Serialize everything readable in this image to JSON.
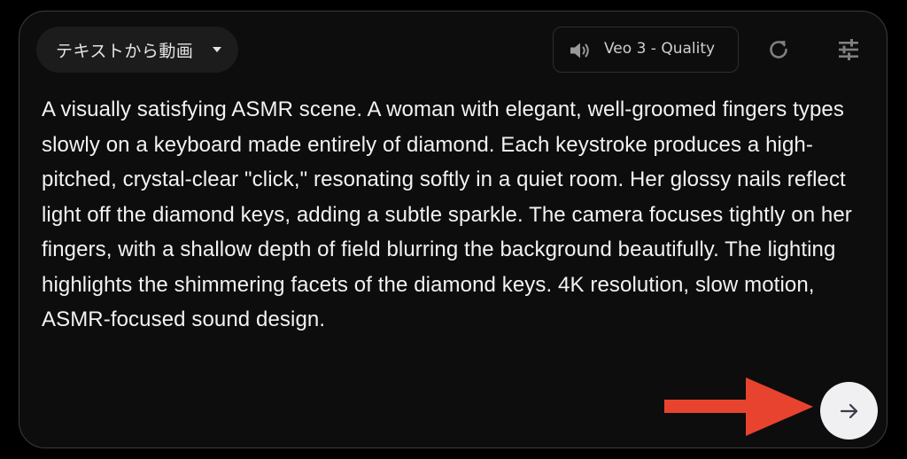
{
  "toolbar": {
    "mode_label": "テキストから動画",
    "mode_icon": "caret-down-icon",
    "model_label": "Veo 3 - Quality",
    "model_icon": "speaker-icon",
    "reset_icon": "refresh-icon",
    "settings_icon": "sliders-icon"
  },
  "prompt": {
    "text": "A visually satisfying ASMR scene. A woman with elegant, well-groomed fingers types slowly on a keyboard made entirely of diamond. Each keystroke produces a high-pitched, crystal-clear \"click,\" resonating softly in a quiet room. Her glossy nails reflect light off the diamond keys, adding a subtle sparkle. The camera focuses tightly on her fingers, with a shallow depth of field blurring the background beautifully. The lighting highlights the shimmering facets of the diamond keys. 4K resolution, slow motion, ASMR-focused sound design."
  },
  "submit": {
    "icon": "arrow-right-icon"
  },
  "annotation": {
    "icon": "red-arrow-pointer",
    "color": "#e8432e"
  },
  "colors": {
    "background": "#000000",
    "panel": "#0d0d0d",
    "panel_border": "#3c3c3c",
    "text": "#f2f2f2",
    "icon": "#8a8a8a",
    "submit_bg": "#f0f0f3"
  }
}
